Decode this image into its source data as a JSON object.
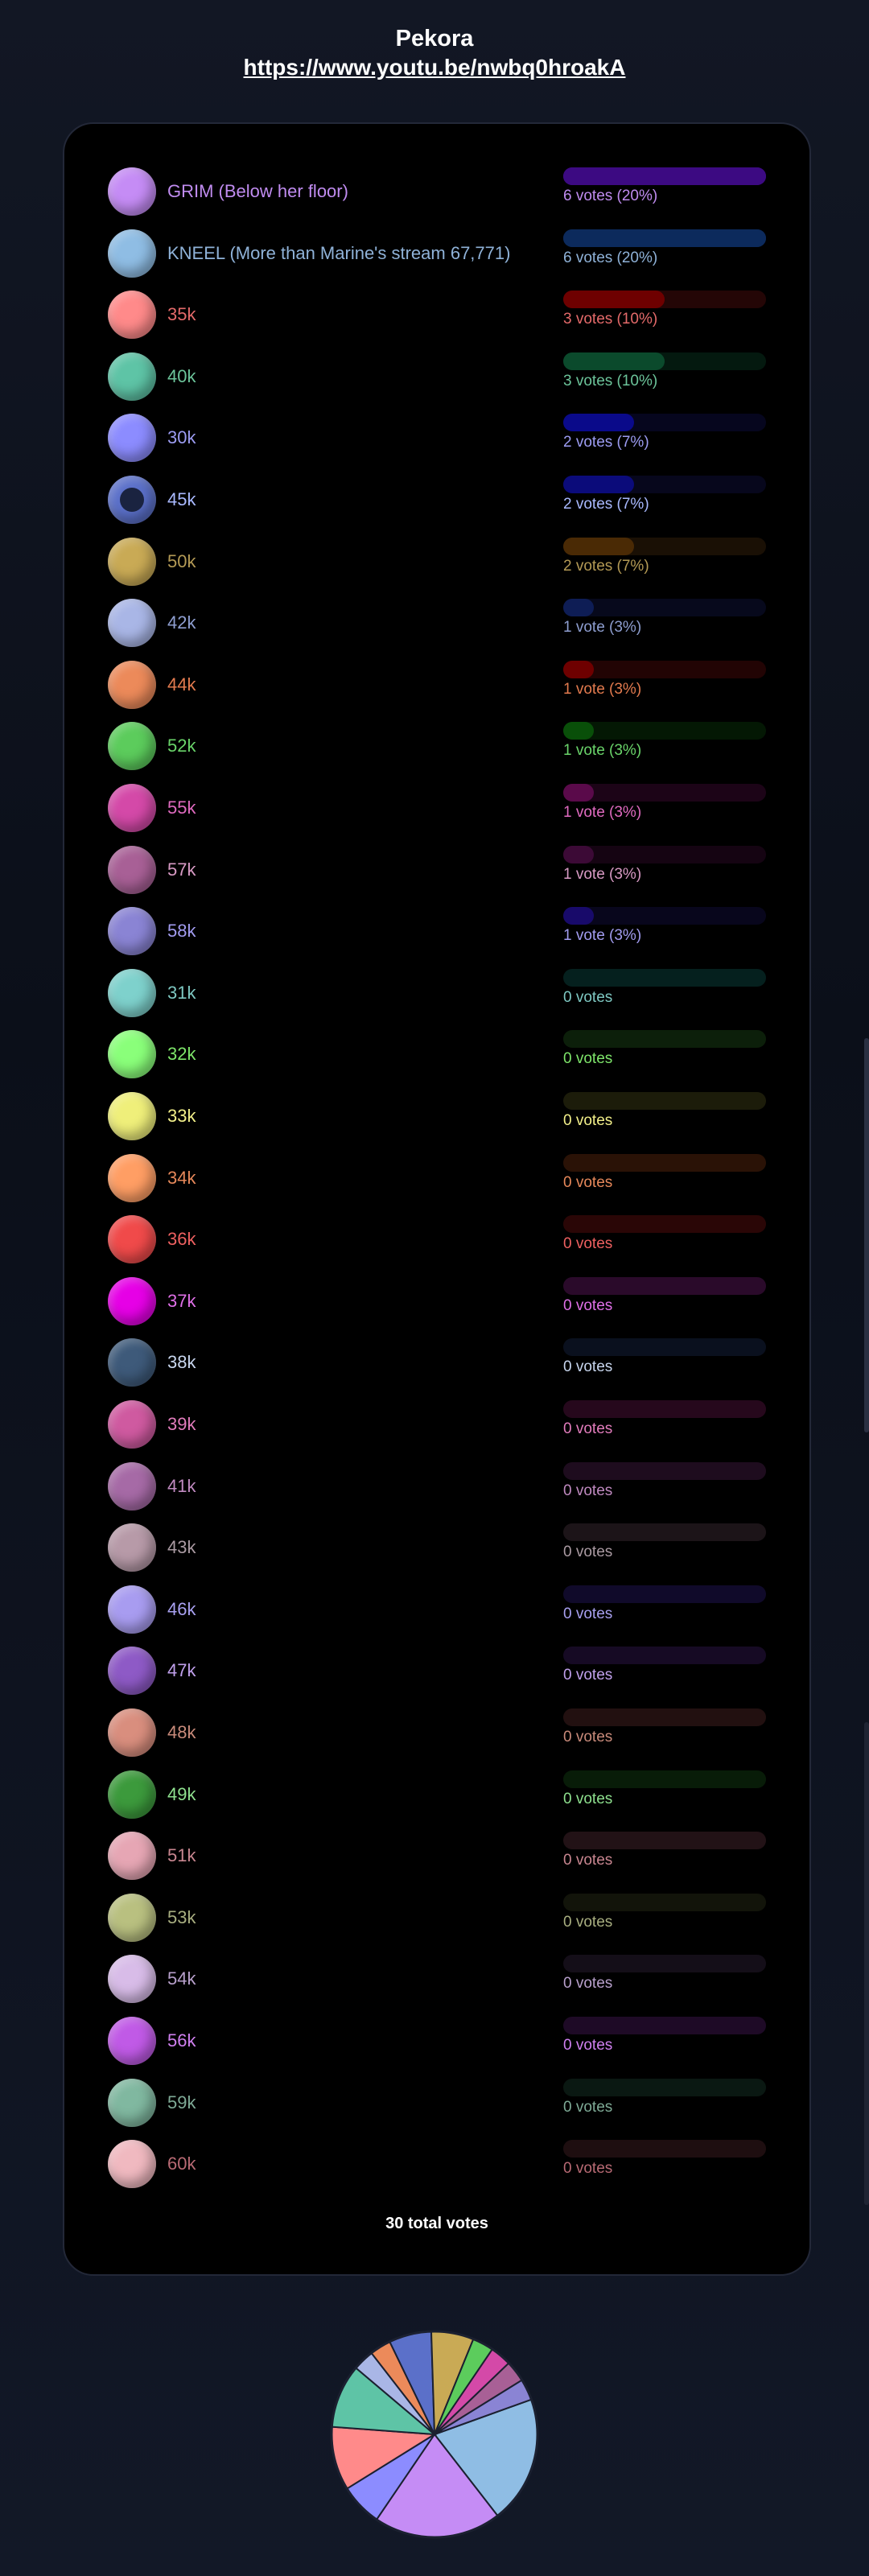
{
  "page": {
    "title": "Pekora",
    "link": "https://www.youtu.be/nwbq0hroakA"
  },
  "poll": {
    "total_label": "30 total votes",
    "options": [
      {
        "label": "GRIM (Below her floor)",
        "votes": "6 votes (20%)",
        "pct": 20,
        "color": "#c58cf5",
        "bar": "#3c0a82",
        "track": "#3c0a82",
        "text": "#c08cf0"
      },
      {
        "label": "KNEEL (More than Marine's stream 67,771)",
        "votes": "6 votes (20%)",
        "pct": 20,
        "color": "#8fbde4",
        "bar": "#0c2a5c",
        "track": "#0c2a5c",
        "text": "#8fb2d8"
      },
      {
        "label": "35k",
        "votes": "3 votes (10%)",
        "pct": 10,
        "color": "#ff8a8a",
        "bar": "#6e0000",
        "track": "#240606",
        "text": "#e46a6a"
      },
      {
        "label": "40k",
        "votes": "3 votes (10%)",
        "pct": 10,
        "color": "#5ec4a6",
        "bar": "#0b4a2c",
        "track": "#04190f",
        "text": "#6cc49a"
      },
      {
        "label": "30k",
        "votes": "2 votes (7%)",
        "pct": 7,
        "color": "#8c8cff",
        "bar": "#0a0a8a",
        "track": "#06061e",
        "text": "#9c9cf2"
      },
      {
        "label": "45k",
        "votes": "2 votes (7%)",
        "pct": 7,
        "color": "#5b70c9",
        "bar": "#0b0b7a",
        "track": "#07071c",
        "text": "#a9b9ff",
        "selected": true
      },
      {
        "label": "50k",
        "votes": "2 votes (7%)",
        "pct": 7,
        "color": "#c9aa55",
        "bar": "#4a2a05",
        "track": "#1a1005",
        "text": "#b49a55"
      },
      {
        "label": "42k",
        "votes": "1 vote (3%)",
        "pct": 3,
        "color": "#a9b6e6",
        "bar": "#0e1d55",
        "track": "#07091c",
        "text": "#8e9ed0"
      },
      {
        "label": "44k",
        "votes": "1 vote (3%)",
        "pct": 3,
        "color": "#ec8a5a",
        "bar": "#6e0000",
        "track": "#220404",
        "text": "#e27a4e"
      },
      {
        "label": "52k",
        "votes": "1 vote (3%)",
        "pct": 3,
        "color": "#5ccc5c",
        "bar": "#094f09",
        "track": "#041804",
        "text": "#6ad46a"
      },
      {
        "label": "55k",
        "votes": "1 vote (3%)",
        "pct": 3,
        "color": "#d449a8",
        "bar": "#5a0a4a",
        "track": "#1c0417",
        "text": "#e06ac0"
      },
      {
        "label": "57k",
        "votes": "1 vote (3%)",
        "pct": 3,
        "color": "#a86096",
        "bar": "#3c0a36",
        "track": "#150412",
        "text": "#d89ac4"
      },
      {
        "label": "58k",
        "votes": "1 vote (3%)",
        "pct": 3,
        "color": "#8a84d4",
        "bar": "#180a6a",
        "track": "#08061c",
        "text": "#a29cf0"
      },
      {
        "label": "31k",
        "votes": "0 votes",
        "pct": 0,
        "color": "#7ed1cc",
        "bar": "#05201e",
        "track": "#05201e",
        "text": "#7ec8c2"
      },
      {
        "label": "32k",
        "votes": "0 votes",
        "pct": 0,
        "color": "#8aff7a",
        "bar": "#0c1f0a",
        "track": "#0c1f0a",
        "text": "#7ee56a"
      },
      {
        "label": "33k",
        "votes": "0 votes",
        "pct": 0,
        "color": "#efef7a",
        "bar": "#1c1c0a",
        "track": "#1c1c0a",
        "text": "#f3f08a"
      },
      {
        "label": "34k",
        "votes": "0 votes",
        "pct": 0,
        "color": "#ff9e64",
        "bar": "#2a1206",
        "track": "#2a1206",
        "text": "#e6885a"
      },
      {
        "label": "36k",
        "votes": "0 votes",
        "pct": 0,
        "color": "#f04a4a",
        "bar": "#2a0606",
        "track": "#2a0606",
        "text": "#ee6060"
      },
      {
        "label": "37k",
        "votes": "0 votes",
        "pct": 0,
        "color": "#e600e6",
        "bar": "#2a0a2a",
        "track": "#2a0a2a",
        "text": "#e070e8"
      },
      {
        "label": "38k",
        "votes": "0 votes",
        "pct": 0,
        "color": "#3e5a7a",
        "bar": "#0a101e",
        "track": "#0a101e",
        "text": "#c8d6ee"
      },
      {
        "label": "39k",
        "votes": "0 votes",
        "pct": 0,
        "color": "#cf5aa0",
        "bar": "#26081c",
        "track": "#26081c",
        "text": "#e27cbc"
      },
      {
        "label": "41k",
        "votes": "0 votes",
        "pct": 0,
        "color": "#a66aa6",
        "bar": "#1e0c1e",
        "track": "#1e0c1e",
        "text": "#c08ac0"
      },
      {
        "label": "43k",
        "votes": "0 votes",
        "pct": 0,
        "color": "#b79aa8",
        "bar": "#1c1418",
        "track": "#1c1418",
        "text": "#aa9aa2"
      },
      {
        "label": "46k",
        "votes": "0 votes",
        "pct": 0,
        "color": "#a89cf0",
        "bar": "#100a2a",
        "track": "#100a2a",
        "text": "#a8a0f0"
      },
      {
        "label": "47k",
        "votes": "0 votes",
        "pct": 0,
        "color": "#8e5ac6",
        "bar": "#160a24",
        "track": "#160a24",
        "text": "#c0a0ec"
      },
      {
        "label": "48k",
        "votes": "0 votes",
        "pct": 0,
        "color": "#d98e7e",
        "bar": "#221010",
        "track": "#221010",
        "text": "#c88a7a"
      },
      {
        "label": "49k",
        "votes": "0 votes",
        "pct": 0,
        "color": "#3c9a3c",
        "bar": "#081c08",
        "track": "#081c08",
        "text": "#8ee08e"
      },
      {
        "label": "51k",
        "votes": "0 votes",
        "pct": 0,
        "color": "#e6a6b4",
        "bar": "#221216",
        "track": "#221216",
        "text": "#c88690"
      },
      {
        "label": "53k",
        "votes": "0 votes",
        "pct": 0,
        "color": "#b9c080",
        "bar": "#12140a",
        "track": "#12140a",
        "text": "#a8ae80"
      },
      {
        "label": "54k",
        "votes": "0 votes",
        "pct": 0,
        "color": "#d8bce8",
        "bar": "#140e18",
        "track": "#140e18",
        "text": "#b8a0cc"
      },
      {
        "label": "56k",
        "votes": "0 votes",
        "pct": 0,
        "color": "#c05ae6",
        "bar": "#1e0a26",
        "track": "#1e0a26",
        "text": "#d080f0"
      },
      {
        "label": "59k",
        "votes": "0 votes",
        "pct": 0,
        "color": "#80b8a0",
        "bar": "#0a1812",
        "track": "#0a1812",
        "text": "#7eaa96"
      },
      {
        "label": "60k",
        "votes": "0 votes",
        "pct": 0,
        "color": "#f0b9c0",
        "bar": "#1e0e10",
        "track": "#1e0e10",
        "text": "#b86a74"
      }
    ]
  },
  "chart_data": {
    "type": "pie",
    "slices": [
      {
        "label": "KNEEL (More than Marine's stream 67,771)",
        "value": 6,
        "color": "#8fbde4"
      },
      {
        "label": "GRIM (Below her floor)",
        "value": 6,
        "color": "#c58cf5"
      },
      {
        "label": "30k",
        "value": 2,
        "color": "#8c8cff"
      },
      {
        "label": "35k",
        "value": 3,
        "color": "#ff8a8a"
      },
      {
        "label": "40k",
        "value": 3,
        "color": "#5ec4a6"
      },
      {
        "label": "42k",
        "value": 1,
        "color": "#a9b6e6"
      },
      {
        "label": "44k",
        "value": 1,
        "color": "#ec8a5a"
      },
      {
        "label": "45k",
        "value": 2,
        "color": "#5b70c9"
      },
      {
        "label": "50k",
        "value": 2,
        "color": "#c9aa55"
      },
      {
        "label": "52k",
        "value": 1,
        "color": "#5ccc5c"
      },
      {
        "label": "55k",
        "value": 1,
        "color": "#d449a8"
      },
      {
        "label": "57k",
        "value": 1,
        "color": "#a86096"
      },
      {
        "label": "58k",
        "value": 1,
        "color": "#8a84d4"
      }
    ]
  }
}
